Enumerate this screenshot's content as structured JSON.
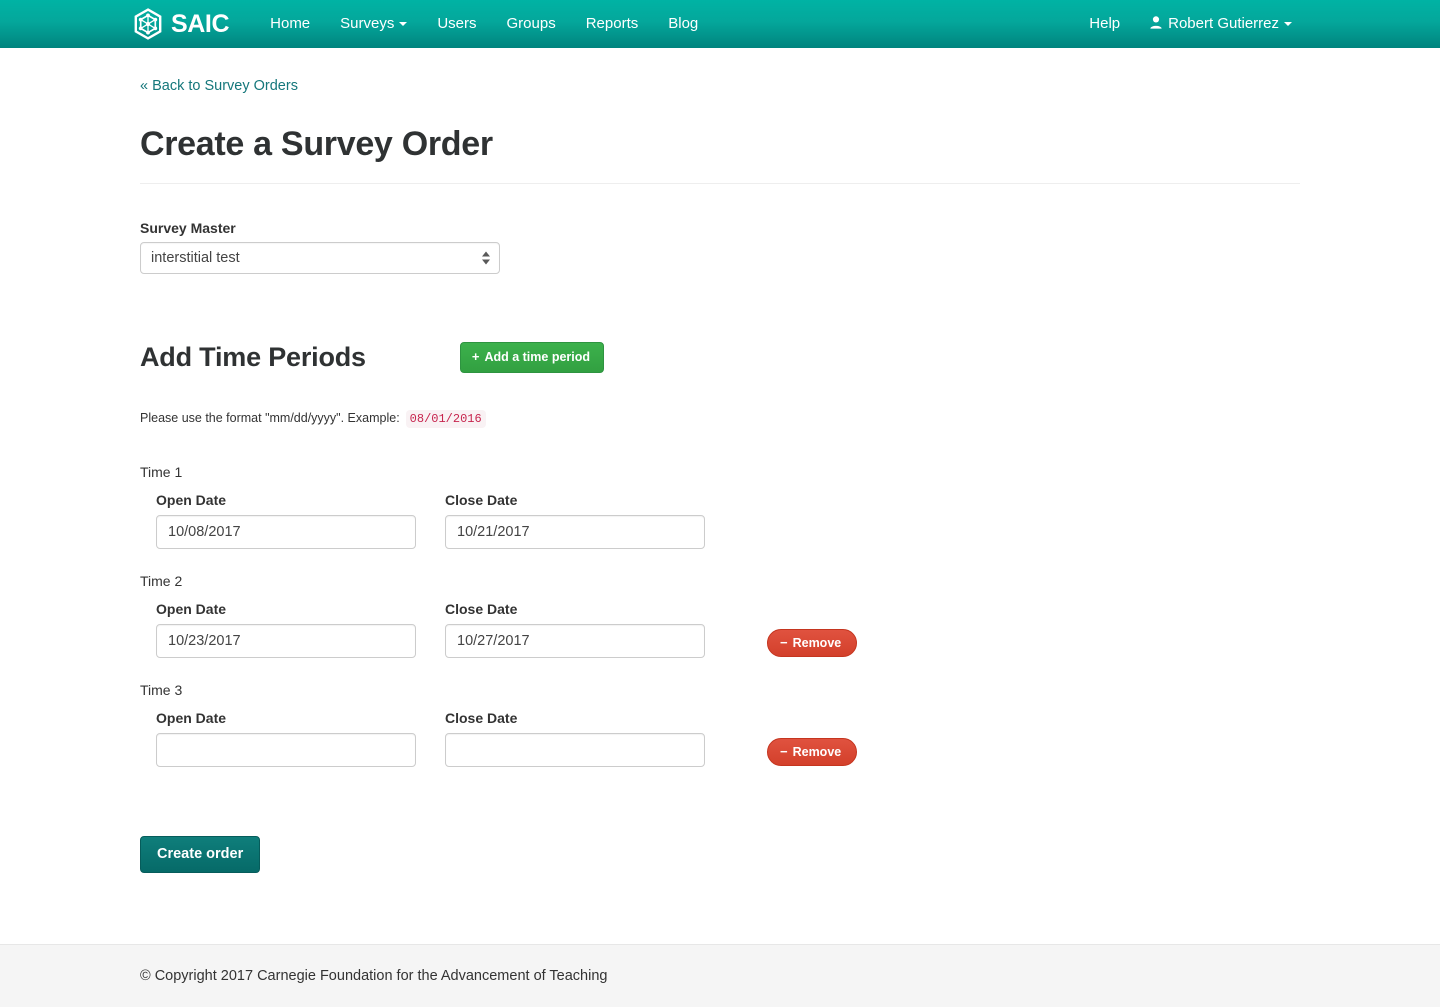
{
  "navbar": {
    "brand": {
      "label": "SAIC",
      "icon": "hexagon-molecule-logo"
    },
    "links": [
      {
        "label": "Home",
        "has_caret": false
      },
      {
        "label": "Surveys",
        "has_caret": true
      },
      {
        "label": "Users",
        "has_caret": false
      },
      {
        "label": "Groups",
        "has_caret": false
      },
      {
        "label": "Reports",
        "has_caret": false
      },
      {
        "label": "Blog",
        "has_caret": false
      }
    ],
    "help_label": "Help",
    "user_label": "Robert Gutierrez"
  },
  "page": {
    "back_link": "« Back to Survey Orders",
    "title": "Create a Survey Order"
  },
  "survey_master": {
    "label": "Survey Master",
    "selected": "interstitial test",
    "options": [
      "interstitial test"
    ]
  },
  "time_periods": {
    "section_title": "Add Time Periods",
    "add_button_label": "Add a time period",
    "add_button_icon": "plus-icon",
    "format_note_prefix": "Please use the format \"mm/dd/yyyy\". Example:",
    "format_example": "08/01/2016",
    "open_date_label": "Open Date",
    "close_date_label": "Close Date",
    "remove_button_label": "Remove",
    "remove_button_icon": "minus-icon",
    "rows": [
      {
        "legend": "Time 1",
        "open_date": "10/08/2017",
        "close_date": "10/21/2017",
        "has_remove": false
      },
      {
        "legend": "Time 2",
        "open_date": "10/23/2017",
        "close_date": "10/27/2017",
        "has_remove": true
      },
      {
        "legend": "Time 3",
        "open_date": "",
        "close_date": "",
        "has_remove": true
      }
    ]
  },
  "submit": {
    "create_order_label": "Create order"
  },
  "footer": {
    "copyright": "© Copyright 2017 Carnegie Foundation for the Advancement of Teaching"
  },
  "colors": {
    "navbar_top": "#00b3a4",
    "navbar_bottom": "#00847e",
    "link_teal": "#15777b",
    "add_green": "#32a041",
    "remove_red": "#d3402b",
    "create_teal": "#0f7e7b",
    "code_red": "#c7254e",
    "code_bg": "#f9f2f4"
  }
}
